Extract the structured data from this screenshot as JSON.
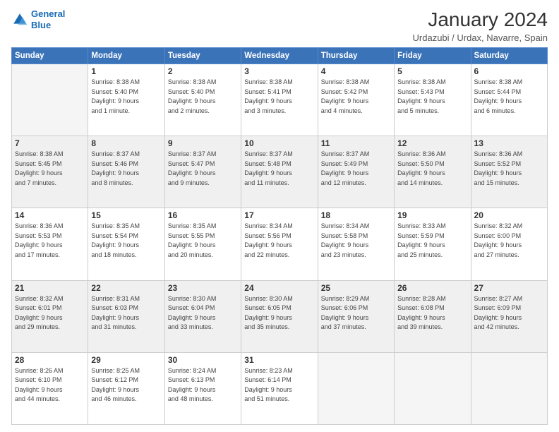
{
  "logo": {
    "line1": "General",
    "line2": "Blue"
  },
  "title": "January 2024",
  "subtitle": "Urdazubi / Urdax, Navarre, Spain",
  "headers": [
    "Sunday",
    "Monday",
    "Tuesday",
    "Wednesday",
    "Thursday",
    "Friday",
    "Saturday"
  ],
  "weeks": [
    [
      {
        "day": "",
        "info": ""
      },
      {
        "day": "1",
        "info": "Sunrise: 8:38 AM\nSunset: 5:40 PM\nDaylight: 9 hours\nand 1 minute."
      },
      {
        "day": "2",
        "info": "Sunrise: 8:38 AM\nSunset: 5:40 PM\nDaylight: 9 hours\nand 2 minutes."
      },
      {
        "day": "3",
        "info": "Sunrise: 8:38 AM\nSunset: 5:41 PM\nDaylight: 9 hours\nand 3 minutes."
      },
      {
        "day": "4",
        "info": "Sunrise: 8:38 AM\nSunset: 5:42 PM\nDaylight: 9 hours\nand 4 minutes."
      },
      {
        "day": "5",
        "info": "Sunrise: 8:38 AM\nSunset: 5:43 PM\nDaylight: 9 hours\nand 5 minutes."
      },
      {
        "day": "6",
        "info": "Sunrise: 8:38 AM\nSunset: 5:44 PM\nDaylight: 9 hours\nand 6 minutes."
      }
    ],
    [
      {
        "day": "7",
        "info": "Sunrise: 8:38 AM\nSunset: 5:45 PM\nDaylight: 9 hours\nand 7 minutes."
      },
      {
        "day": "8",
        "info": "Sunrise: 8:37 AM\nSunset: 5:46 PM\nDaylight: 9 hours\nand 8 minutes."
      },
      {
        "day": "9",
        "info": "Sunrise: 8:37 AM\nSunset: 5:47 PM\nDaylight: 9 hours\nand 9 minutes."
      },
      {
        "day": "10",
        "info": "Sunrise: 8:37 AM\nSunset: 5:48 PM\nDaylight: 9 hours\nand 11 minutes."
      },
      {
        "day": "11",
        "info": "Sunrise: 8:37 AM\nSunset: 5:49 PM\nDaylight: 9 hours\nand 12 minutes."
      },
      {
        "day": "12",
        "info": "Sunrise: 8:36 AM\nSunset: 5:50 PM\nDaylight: 9 hours\nand 14 minutes."
      },
      {
        "day": "13",
        "info": "Sunrise: 8:36 AM\nSunset: 5:52 PM\nDaylight: 9 hours\nand 15 minutes."
      }
    ],
    [
      {
        "day": "14",
        "info": "Sunrise: 8:36 AM\nSunset: 5:53 PM\nDaylight: 9 hours\nand 17 minutes."
      },
      {
        "day": "15",
        "info": "Sunrise: 8:35 AM\nSunset: 5:54 PM\nDaylight: 9 hours\nand 18 minutes."
      },
      {
        "day": "16",
        "info": "Sunrise: 8:35 AM\nSunset: 5:55 PM\nDaylight: 9 hours\nand 20 minutes."
      },
      {
        "day": "17",
        "info": "Sunrise: 8:34 AM\nSunset: 5:56 PM\nDaylight: 9 hours\nand 22 minutes."
      },
      {
        "day": "18",
        "info": "Sunrise: 8:34 AM\nSunset: 5:58 PM\nDaylight: 9 hours\nand 23 minutes."
      },
      {
        "day": "19",
        "info": "Sunrise: 8:33 AM\nSunset: 5:59 PM\nDaylight: 9 hours\nand 25 minutes."
      },
      {
        "day": "20",
        "info": "Sunrise: 8:32 AM\nSunset: 6:00 PM\nDaylight: 9 hours\nand 27 minutes."
      }
    ],
    [
      {
        "day": "21",
        "info": "Sunrise: 8:32 AM\nSunset: 6:01 PM\nDaylight: 9 hours\nand 29 minutes."
      },
      {
        "day": "22",
        "info": "Sunrise: 8:31 AM\nSunset: 6:03 PM\nDaylight: 9 hours\nand 31 minutes."
      },
      {
        "day": "23",
        "info": "Sunrise: 8:30 AM\nSunset: 6:04 PM\nDaylight: 9 hours\nand 33 minutes."
      },
      {
        "day": "24",
        "info": "Sunrise: 8:30 AM\nSunset: 6:05 PM\nDaylight: 9 hours\nand 35 minutes."
      },
      {
        "day": "25",
        "info": "Sunrise: 8:29 AM\nSunset: 6:06 PM\nDaylight: 9 hours\nand 37 minutes."
      },
      {
        "day": "26",
        "info": "Sunrise: 8:28 AM\nSunset: 6:08 PM\nDaylight: 9 hours\nand 39 minutes."
      },
      {
        "day": "27",
        "info": "Sunrise: 8:27 AM\nSunset: 6:09 PM\nDaylight: 9 hours\nand 42 minutes."
      }
    ],
    [
      {
        "day": "28",
        "info": "Sunrise: 8:26 AM\nSunset: 6:10 PM\nDaylight: 9 hours\nand 44 minutes."
      },
      {
        "day": "29",
        "info": "Sunrise: 8:25 AM\nSunset: 6:12 PM\nDaylight: 9 hours\nand 46 minutes."
      },
      {
        "day": "30",
        "info": "Sunrise: 8:24 AM\nSunset: 6:13 PM\nDaylight: 9 hours\nand 48 minutes."
      },
      {
        "day": "31",
        "info": "Sunrise: 8:23 AM\nSunset: 6:14 PM\nDaylight: 9 hours\nand 51 minutes."
      },
      {
        "day": "",
        "info": ""
      },
      {
        "day": "",
        "info": ""
      },
      {
        "day": "",
        "info": ""
      }
    ]
  ]
}
